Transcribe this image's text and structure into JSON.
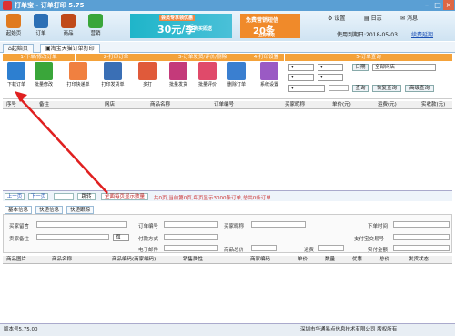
{
  "window": {
    "title": "打单宝 - 订单打印 5.75"
  },
  "toolbar": {
    "buttons": [
      {
        "label": "起始页",
        "icon": "home-icon",
        "color": "#e07a1f"
      },
      {
        "label": "订单",
        "icon": "document-icon",
        "color": "#2b6fb5"
      },
      {
        "label": "商品",
        "icon": "box-icon",
        "color": "#c04a1a"
      },
      {
        "label": "营销",
        "icon": "chat-icon",
        "color": "#3aa63a"
      }
    ],
    "ad1": {
      "line1": "会员专享领优惠",
      "line2": "30元/季",
      "line3": "购买即送"
    },
    "ad2": {
      "line1": "免费营销短信",
      "line2": "20条",
      "line3": "立即领取"
    },
    "links": [
      "设置",
      "日志",
      "消息"
    ],
    "links_icons": [
      "gear-icon",
      "log-icon",
      "chat-icon"
    ],
    "expiry": "使用到期日:2018-05-03",
    "expiry_link": "续费延期"
  },
  "tabs": [
    {
      "label": "起始页"
    },
    {
      "label": "淘宝天猫订单打印"
    }
  ],
  "sections": [
    "1-下单/修改订单",
    "2-打印订单",
    "3-订单发货/评价/删除",
    "4-打印设置",
    "5-订单查询"
  ],
  "actions": [
    {
      "label": "下载订单",
      "icon": "download-icon",
      "color": "#2d7fd0"
    },
    {
      "label": "批量修改",
      "icon": "edit-icon",
      "color": "#3aa63a"
    },
    {
      "label": "打印快递单",
      "icon": "printer-icon",
      "color": "#f08040"
    },
    {
      "label": "打印发货单",
      "icon": "invoice-icon",
      "color": "#3a6fb5"
    },
    {
      "label": "多打",
      "icon": "print-multi-icon",
      "color": "#e05a3a"
    },
    {
      "label": "批量发货",
      "icon": "truck-icon",
      "color": "#c43a7a"
    },
    {
      "label": "批量评价",
      "icon": "heart-icon",
      "color": "#e04a6a"
    },
    {
      "label": "删除订单",
      "icon": "trash-icon",
      "color": "#3a7fd0"
    },
    {
      "label": "系统设置",
      "icon": "gear-icon",
      "color": "#9a5ac4"
    }
  ],
  "query": {
    "shop_placeholder": "全部网店",
    "search_btn": "查询",
    "adv_btn": "高级查询",
    "date_btn": "日期",
    "reset_btn": "查询",
    "restore_btn": "恢复查询"
  },
  "grid": {
    "columns": [
      "序号",
      "备注",
      "网店",
      "商品名称",
      "订单编号",
      "买家昵称",
      "单价(元)",
      "运费(元)",
      "实收款(元)"
    ]
  },
  "pager": {
    "prev": "上一页",
    "next": "下一页",
    "page_value": "",
    "jump": "跳转",
    "show_all": "全面每页显示数量",
    "info": "共0页,当前第0页,每页显示3000条订单,总共0条订单"
  },
  "detail_tabs": [
    "基本信息",
    "快递信息",
    "快递跟踪"
  ],
  "detail": {
    "labels_left": [
      "买家留言",
      "卖家备注"
    ],
    "labels_mid": [
      "订单编号",
      "付款方式",
      "电子邮件"
    ],
    "labels_mid2": [
      "买家昵称",
      "商品总价",
      "运费"
    ],
    "labels_right": [
      "下单时间",
      "支付宝交易号",
      "实付金额"
    ],
    "flag": "旗"
  },
  "grid2": {
    "columns": [
      "商品图片",
      "商品名称",
      "商品编码(商家编码)",
      "销售属性",
      "商家编码",
      "单价",
      "数量",
      "优惠",
      "总价",
      "发货状态"
    ]
  },
  "status": {
    "version": "版本号5.75.00",
    "company": "深圳市华通易点信息技术有限公司 版权所有"
  }
}
